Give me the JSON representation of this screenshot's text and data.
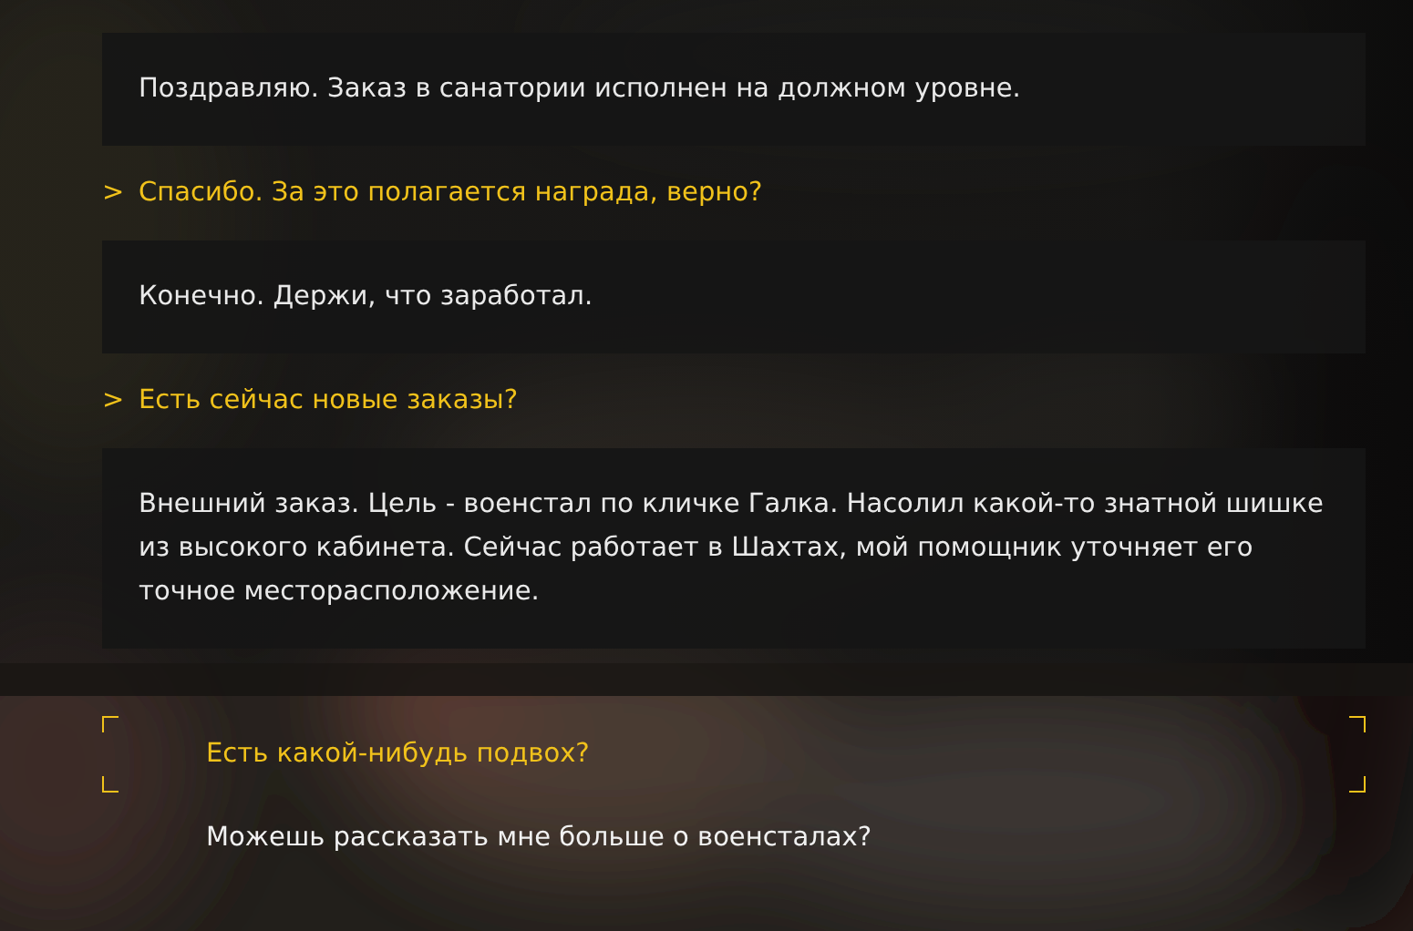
{
  "log": [
    {
      "kind": "npc",
      "text": "Поздравляю. Заказ в санатории исполнен на должном уровне."
    },
    {
      "kind": "player",
      "marker": ">",
      "text": "Спасибо. За это полагается награда, верно?"
    },
    {
      "kind": "npc",
      "text": "Конечно. Держи, что заработал."
    },
    {
      "kind": "player",
      "marker": ">",
      "text": "Есть сейчас новые заказы?"
    },
    {
      "kind": "npc",
      "text": "Внешний заказ. Цель - военстал по кличке Галка. Насолил какой-то знатной шишке из высокого кабинета. Сейчас работает в Шахтах, мой помощник уточняет его точное месторасположение."
    }
  ],
  "choices": [
    {
      "text": "Есть какой-нибудь подвох?",
      "selected": true
    },
    {
      "text": "Можешь рассказать мне больше о военсталах?",
      "selected": false
    }
  ]
}
